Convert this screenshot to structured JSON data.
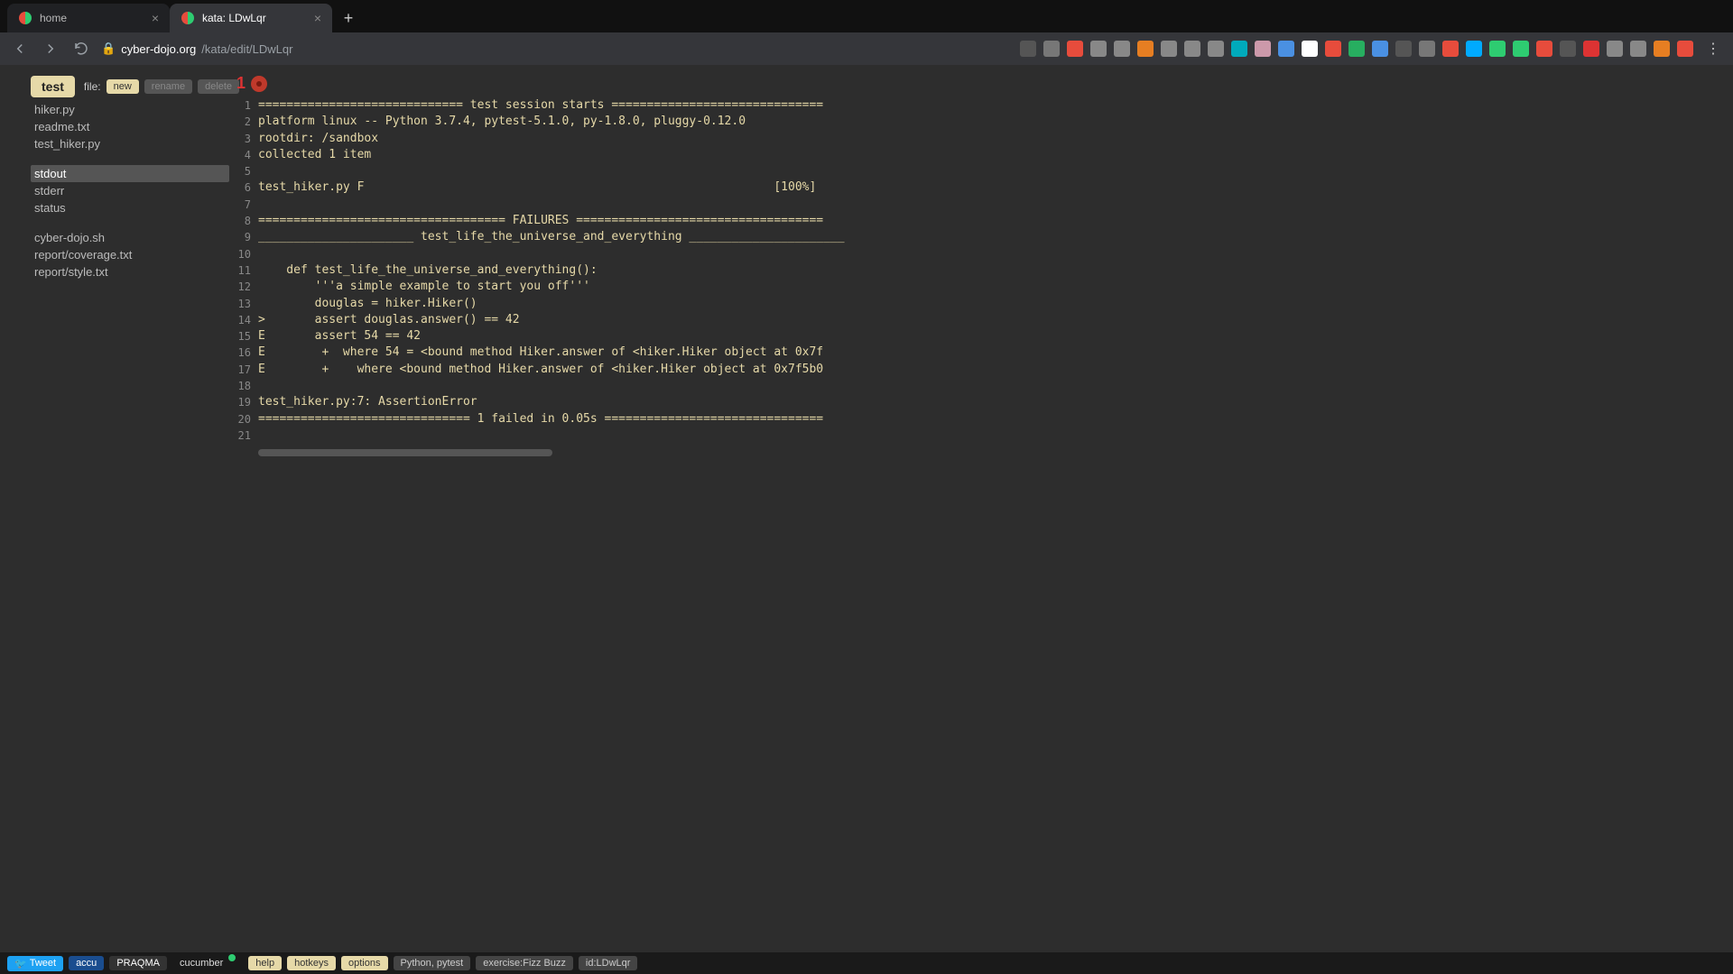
{
  "browser": {
    "tabs": [
      {
        "title": "home",
        "active": false
      },
      {
        "title": "kata: LDwLqr",
        "active": true
      }
    ],
    "url_host": "cyber-dojo.org",
    "url_path": "/kata/edit/LDwLqr"
  },
  "toolbar": {
    "test_label": "test",
    "file_label": "file:",
    "new_label": "new",
    "rename_label": "rename",
    "delete_label": "delete"
  },
  "sidebar": {
    "group1": [
      "hiker.py",
      "readme.txt",
      "test_hiker.py"
    ],
    "group2": [
      "stdout",
      "stderr",
      "status"
    ],
    "group3": [
      "cyber-dojo.sh",
      "report/coverage.txt",
      "report/style.txt"
    ],
    "selected": "stdout"
  },
  "indicator": {
    "num": "1"
  },
  "code_lines": [
    "============================= test session starts ==============================",
    "platform linux -- Python 3.7.4, pytest-5.1.0, py-1.8.0, pluggy-0.12.0",
    "rootdir: /sandbox",
    "collected 1 item",
    "",
    "test_hiker.py F                                                          [100%]",
    "",
    "=================================== FAILURES ===================================",
    "______________________ test_life_the_universe_and_everything ______________________",
    "",
    "    def test_life_the_universe_and_everything():",
    "        '''a simple example to start you off'''",
    "        douglas = hiker.Hiker()",
    ">       assert douglas.answer() == 42",
    "E       assert 54 == 42",
    "E        +  where 54 = <bound method Hiker.answer of <hiker.Hiker object at 0x7f",
    "E        +    where <bound method Hiker.answer of <hiker.Hiker object at 0x7f5b0",
    "",
    "test_hiker.py:7: AssertionError",
    "============================== 1 failed in 0.05s ===============================",
    ""
  ],
  "bottom": {
    "tweet": "Tweet",
    "accu": "accu",
    "praqma": "PRAQMA",
    "cucumber": "cucumber",
    "help": "help",
    "hotkeys": "hotkeys",
    "options": "options",
    "lang": "Python, pytest",
    "exercise": "exercise:Fizz Buzz",
    "id": "id:LDwLqr"
  },
  "ext_colors": [
    "#555",
    "#777",
    "#e74c3c",
    "#888",
    "#888",
    "#e67e22",
    "#888",
    "#888",
    "#888",
    "#0ab",
    "#c9a",
    "#4a90e2",
    "#fff",
    "#e74c3c",
    "#27ae60",
    "#4a90e2",
    "#555",
    "#777",
    "#e74c3c",
    "#0af",
    "#2ecc71",
    "#2ecc71",
    "#e74c3c",
    "#555",
    "#d33",
    "#888",
    "#888",
    "#e67e22",
    "#e74c3c"
  ]
}
